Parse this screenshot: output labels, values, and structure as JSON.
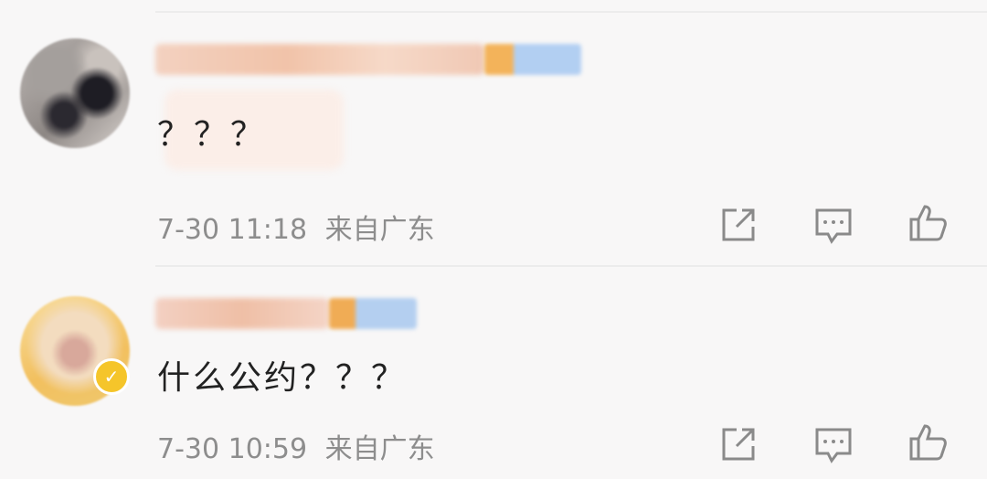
{
  "comments": [
    {
      "text": "？？？",
      "time": "7-30 11:18",
      "location": "来自广东",
      "avatar_icon": "avatar-blurred",
      "actions": [
        "share-icon",
        "comment-icon",
        "like-icon"
      ]
    },
    {
      "text": "什么公约？？？",
      "time": "7-30 10:59",
      "location": "来自广东",
      "avatar_icon": "avatar-blurred-verified",
      "actions": [
        "share-icon",
        "comment-icon",
        "like-icon"
      ]
    }
  ],
  "colors": {
    "background": "#f8f7f7",
    "meta_text": "#8d8d8d",
    "content_text": "#222222",
    "icon": "#8a8a8a",
    "verified_badge": "#f5c52a"
  }
}
